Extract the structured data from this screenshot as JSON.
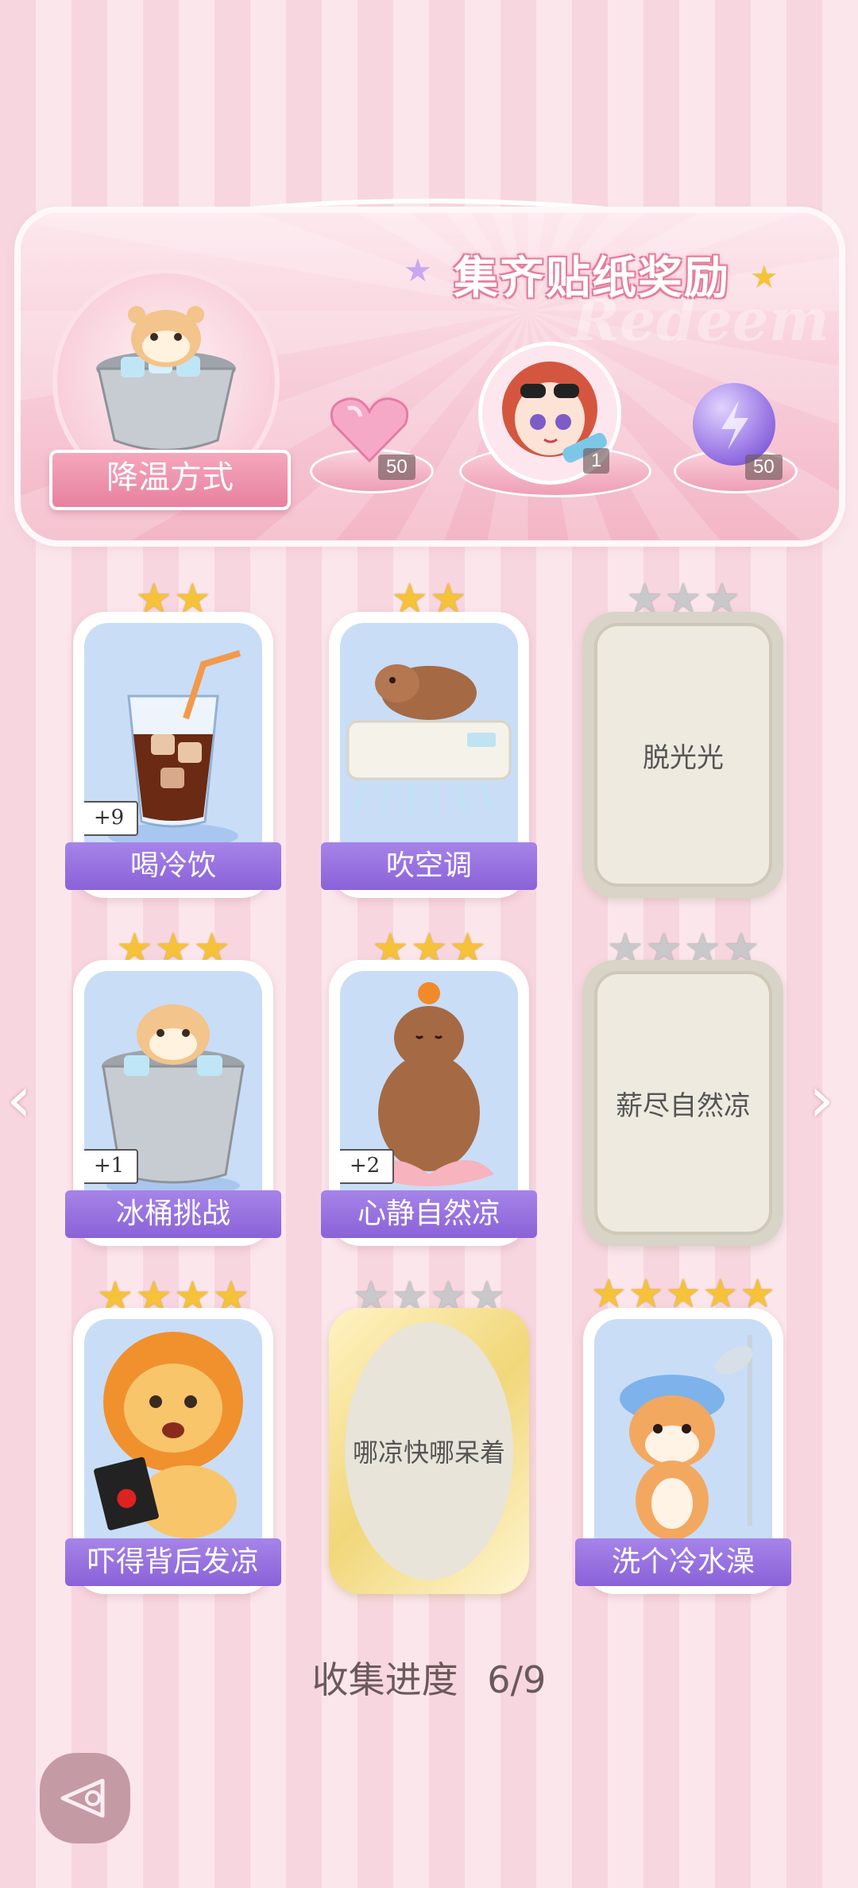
{
  "banner": {
    "title": "集齐贴纸奖励",
    "watermark": "Redeem",
    "ribbon_label": "降温方式",
    "rewards": [
      {
        "icon": "pink-heart-gem-icon",
        "count": "50"
      },
      {
        "icon": "character-avatar-icon",
        "count": "1"
      },
      {
        "icon": "purple-lightning-orb-icon",
        "count": "50"
      }
    ]
  },
  "stickers": [
    {
      "label": "喝冷饮",
      "stars_total": 2,
      "stars_filled": 2,
      "state": "collected",
      "badge": "+9",
      "icon": "iced-drink-icon"
    },
    {
      "label": "吹空调",
      "stars_total": 2,
      "stars_filled": 2,
      "state": "collected",
      "badge": "",
      "icon": "capybara-air-conditioner-icon"
    },
    {
      "label": "脱光光",
      "stars_total": 3,
      "stars_filled": 0,
      "state": "locked",
      "badge": "",
      "icon": ""
    },
    {
      "label": "冰桶挑战",
      "stars_total": 3,
      "stars_filled": 3,
      "state": "collected",
      "badge": "+1",
      "icon": "hamster-ice-bucket-icon"
    },
    {
      "label": "心静自然凉",
      "stars_total": 3,
      "stars_filled": 3,
      "state": "collected",
      "badge": "+2",
      "icon": "capybara-lotus-icon"
    },
    {
      "label": "薪尽自然凉",
      "stars_total": 4,
      "stars_filled": 0,
      "state": "locked",
      "badge": "",
      "icon": ""
    },
    {
      "label": "吓得背后发凉",
      "stars_total": 4,
      "stars_filled": 4,
      "state": "collected",
      "badge": "",
      "icon": "scared-lion-icon"
    },
    {
      "label": "哪凉快哪呆着",
      "stars_total": 4,
      "stars_filled": 0,
      "state": "locked-gold",
      "badge": "",
      "icon": ""
    },
    {
      "label": "洗个冷水澡",
      "stars_total": 5,
      "stars_filled": 5,
      "state": "collected",
      "badge": "",
      "icon": "cat-shower-icon"
    }
  ],
  "progress": {
    "label": "收集进度",
    "value": "6/9"
  },
  "nav": {
    "left_icon": "chevron-left-icon",
    "right_icon": "chevron-right-icon"
  },
  "colors": {
    "label_bar": "#9a72e0",
    "star_gold": "#f5c23a",
    "star_gray": "#c9c9cc",
    "card_bg": "#c9ddf7"
  }
}
